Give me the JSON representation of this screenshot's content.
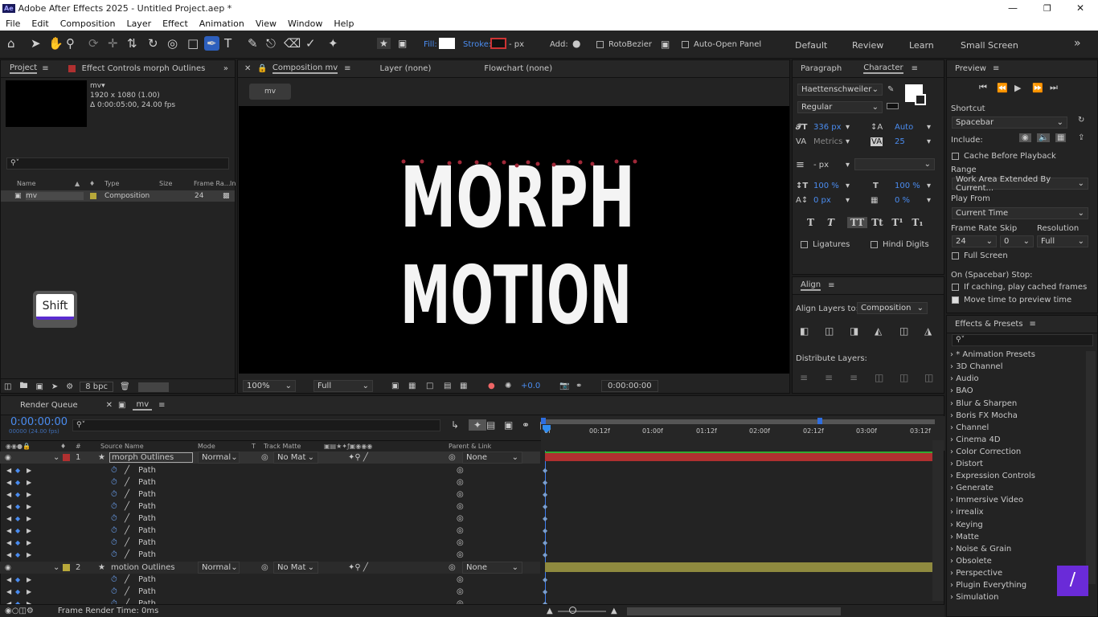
{
  "window": {
    "title": "Adobe After Effects 2025 - Untitled Project.aep *",
    "logo": "Ae"
  },
  "menu": [
    "File",
    "Edit",
    "Composition",
    "Layer",
    "Effect",
    "Animation",
    "View",
    "Window",
    "Help"
  ],
  "toolbar": {
    "fill_label": "Fill:",
    "stroke_label": "Stroke:",
    "stroke_unit": "- px",
    "add_label": "Add:",
    "rotobezier": "RotoBezier",
    "auto_open": "Auto-Open Panel",
    "workspaces": [
      "Default",
      "Review",
      "Learn",
      "Small Screen"
    ]
  },
  "project": {
    "tab": "Project",
    "effect_controls": "Effect Controls morph Outlines",
    "comp_name": "mv▾",
    "comp_res": "1920 x 1080 (1.00)",
    "comp_dur": "Δ 0:00:05:00, 24.00 fps",
    "columns": [
      "Name",
      "Type",
      "Size",
      "Frame Ra...",
      "In"
    ],
    "item": {
      "name": "mv",
      "type": "Composition",
      "fps": "24"
    },
    "bpc": "8 bpc",
    "shift_key": "Shift"
  },
  "composition": {
    "tab": "Composition mv",
    "layer_tab": "Layer (none)",
    "flowchart_tab": "Flowchart (none)",
    "crumb": "mv",
    "words": [
      "MORPH",
      "MOTION"
    ],
    "zoom": "100%",
    "quality": "Full",
    "exposure": "+0.0",
    "timecode": "0:00:00:00"
  },
  "character": {
    "paragraph_tab": "Paragraph",
    "character_tab": "Character",
    "font": "Haettenschweiler",
    "style": "Regular",
    "size": "336 px",
    "leading": "Auto",
    "kerning": "Metrics",
    "tracking": "25",
    "stroke_width": "- px",
    "vscale": "100 %",
    "hscale": "100 %",
    "baseline": "0 px",
    "tsume": "0 %",
    "ligatures": "Ligatures",
    "hindi": "Hindi Digits",
    "caps": [
      "T",
      "T",
      "TT",
      "Tt",
      "T¹",
      "T₁"
    ]
  },
  "align": {
    "tab": "Align",
    "align_to_label": "Align Layers to:",
    "align_to": "Composition",
    "distribute": "Distribute Layers:"
  },
  "preview": {
    "tab": "Preview",
    "shortcut_label": "Shortcut",
    "shortcut": "Spacebar",
    "include": "Include:",
    "cache": "Cache Before Playback",
    "range_label": "Range",
    "range": "Work Area Extended By Current...",
    "play_from_label": "Play From",
    "play_from": "Current Time",
    "frame_rate_label": "Frame Rate",
    "skip_label": "Skip",
    "resolution_label": "Resolution",
    "frame_rate": "24",
    "skip": "0",
    "resolution": "Full",
    "full_screen": "Full Screen",
    "stop_label": "On (Spacebar) Stop:",
    "cached": "If caching, play cached frames",
    "move_time": "Move time to preview time"
  },
  "effects": {
    "tab": "Effects & Presets",
    "items": [
      "* Animation Presets",
      "3D Channel",
      "Audio",
      "BAO",
      "Blur & Sharpen",
      "Boris FX Mocha",
      "Channel",
      "Cinema 4D",
      "Color Correction",
      "Distort",
      "Expression Controls",
      "Generate",
      "Immersive Video",
      "irrealix",
      "Keying",
      "Matte",
      "Noise & Grain",
      "Obsolete",
      "Perspective",
      "Plugin Everything",
      "Simulation"
    ]
  },
  "timeline": {
    "render_queue": "Render Queue",
    "comp_tab": "mv",
    "timecode": "0:00:00:00",
    "timecode_sub": "00000 (24.00 fps)",
    "columns": {
      "source": "Source Name",
      "mode": "Mode",
      "t": "T",
      "track_matte": "Track Matte",
      "parent": "Parent & Link"
    },
    "ruler": [
      "0f",
      "00:12f",
      "01:00f",
      "01:12f",
      "02:00f",
      "02:12f",
      "03:00f",
      "03:12f"
    ],
    "layers": [
      {
        "num": "1",
        "name": "morph Outlines",
        "mode": "Normal",
        "matte": "No Mat",
        "parent": "None",
        "color": "#b03030"
      },
      {
        "num": "2",
        "name": "motion Outlines",
        "mode": "Normal",
        "matte": "No Mat",
        "parent": "None",
        "color": "#b8a83a"
      }
    ],
    "path_label": "Path",
    "render_time": "Frame Render Time: 0ms"
  }
}
